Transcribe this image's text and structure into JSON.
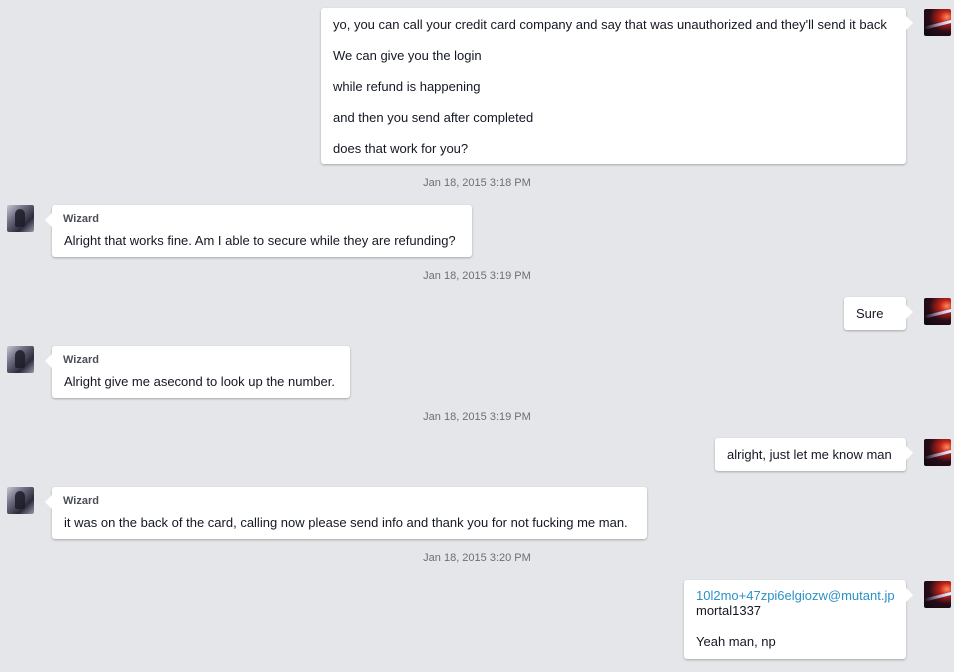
{
  "conversation": {
    "wizard_name": "Wizard",
    "messages": [
      {
        "from": "me",
        "lines": [
          "yo, you can call your credit card company and say that was unauthorized and they'll send it back",
          "We can give you the login",
          "while refund is happening",
          "and then you send after completed",
          "does that work for you?"
        ]
      },
      {
        "timestamp": "Jan 18, 2015 3:18 PM"
      },
      {
        "from": "Wizard",
        "lines": [
          "Alright that works fine. Am I able to secure while they are refunding?"
        ]
      },
      {
        "timestamp": "Jan 18, 2015 3:19 PM"
      },
      {
        "from": "me",
        "lines": [
          "Sure"
        ]
      },
      {
        "from": "Wizard",
        "lines": [
          "Alright give me asecond to look up the number."
        ]
      },
      {
        "timestamp": "Jan 18, 2015 3:19 PM"
      },
      {
        "from": "me",
        "lines": [
          "alright, just let me know man"
        ]
      },
      {
        "from": "Wizard",
        "lines": [
          "it was on the back of the card, calling now please send info and thank you for not fucking me man."
        ]
      },
      {
        "timestamp": "Jan 18, 2015 3:20 PM"
      },
      {
        "from": "me",
        "lines": [
          "10l2mo+47zpi6elgiozw@mutant.jp",
          "mortal1337",
          "Yeah man, np"
        ]
      }
    ]
  }
}
